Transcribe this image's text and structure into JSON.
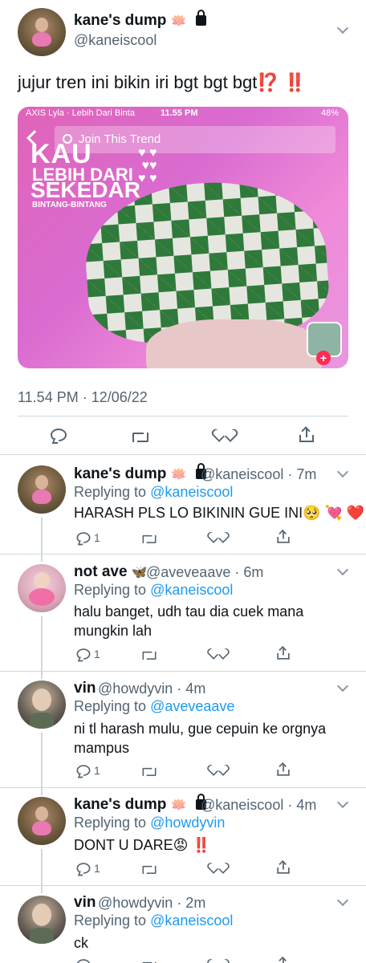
{
  "main_tweet": {
    "name": "kane's dump",
    "name_emoji": "🪷",
    "handle": "@kaneiscool",
    "text": "jujur tren ini bikin iri bgt bgt bgt",
    "text_marks": "⁉️ ‼️",
    "timestamp": "11.54 PM · 12/06/22",
    "media": {
      "status_left": "AXIS  Lyla · Lebih Dari Binta",
      "status_time": "11.55 PM",
      "status_battery": "48%",
      "search_text": "Join This Trend",
      "line1": "KAU",
      "line2": "LEBIH DARI",
      "line3": "SEKEDAR",
      "line4": "BINTANG-BINTANG",
      "hearts": "♥ ♥\n ♥♥\n♥ ♥"
    }
  },
  "replies": [
    {
      "name": "kane's dump",
      "name_emoji": "🪷",
      "handle_time": "@kaneiscool · 7m",
      "replying_prefix": "Replying to ",
      "replying_to": "@kaneiscool",
      "text": "HARASH PLS LO BIKININ GUE INI🥺 💘 ❤️",
      "reply_count": "1",
      "retweet_count": "",
      "like_count": ""
    },
    {
      "name": "not ave",
      "name_emoji": "🦋",
      "handle_time": "@aveveaave · 6m",
      "replying_prefix": "Replying to ",
      "replying_to": "@kaneiscool",
      "text": "halu banget, udh tau dia cuek mana mungkin lah",
      "reply_count": "1",
      "retweet_count": "",
      "like_count": ""
    },
    {
      "name": "vin",
      "name_emoji": "",
      "handle_time": "@howdyvin · 4m",
      "replying_prefix": "Replying to ",
      "replying_to": "@aveveaave",
      "text": "ni tl harash mulu, gue cepuin ke orgnya mampus",
      "reply_count": "1",
      "retweet_count": "",
      "like_count": ""
    },
    {
      "name": "kane's dump",
      "name_emoji": "🪷",
      "handle_time": "@kaneiscool · 4m",
      "replying_prefix": "Replying to ",
      "replying_to": "@howdyvin",
      "text": "DONT U DARE😡 ‼️",
      "reply_count": "1",
      "retweet_count": "",
      "like_count": ""
    },
    {
      "name": "vin",
      "name_emoji": "",
      "handle_time": "@howdyvin · 2m",
      "replying_prefix": "Replying to ",
      "replying_to": "@kaneiscool",
      "text": "ck",
      "reply_count": "",
      "retweet_count": "",
      "like_count": ""
    }
  ],
  "colors": {
    "link": "#1d9bf0",
    "secondary_text": "#536471",
    "divider": "#cfd9de",
    "alert_red": "#e0245e"
  }
}
